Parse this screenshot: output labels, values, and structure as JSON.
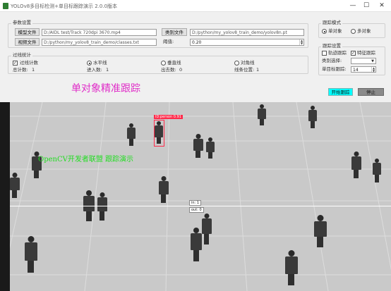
{
  "window": {
    "title": "YOLOv8多目标检测+单目标跟踪演示 2.0.0版本",
    "minimize": "—",
    "maximize": "☐",
    "close": "✕"
  },
  "model_settings": {
    "group_title": "参数设置",
    "model_button": "模型文件",
    "model_path": "D:/AIDL test/Track 720dpi 3670.mp4",
    "class_button": "类别文件",
    "class_path": "D:/python/my_yolov8_train_demo/classes.txt",
    "video_button": "视频文件",
    "video_path": "D:/python/my_yolov8_train_demo/yolov8n.pt",
    "threshold_label": "阈值:",
    "threshold_value": "0.20"
  },
  "line_count": {
    "group_title": "过线统计",
    "enable_label": "过线计数",
    "enable_checked": true,
    "options": [
      {
        "label": "水平线",
        "selected": true
      },
      {
        "label": "垂直线",
        "selected": false
      },
      {
        "label": "对角线",
        "selected": false
      }
    ],
    "total_label": "总计数:",
    "total_value": "1",
    "in_label": "进入数:",
    "in_value": "1",
    "out_label": "出去数:",
    "out_value": "0",
    "line_label": "线条位置:",
    "line_value": "1"
  },
  "detect_mode": {
    "group_title": "跟踪模式",
    "options": [
      {
        "label": "单对象",
        "selected": true
      },
      {
        "label": "多对象",
        "selected": false
      }
    ]
  },
  "track_settings": {
    "group_title": "跟踪设置",
    "trail_label": "轨迹跟踪",
    "trail_checked": false,
    "id_label": "特征跟踪",
    "id_checked": true,
    "class_label": "类别选择:",
    "class_value": "",
    "target_label": "单目标跟踪:",
    "target_value": "14"
  },
  "heading": {
    "text": "单对象精准跟踪",
    "color": "#e02cc8"
  },
  "actions": {
    "start": "开始跟踪",
    "stop": "停止"
  },
  "video": {
    "watermark": "OpenCV开发者联盟  跟踪演示",
    "target_label": "ID:person  0.91",
    "count_in": "in: 1",
    "count_out": "out: 0"
  }
}
